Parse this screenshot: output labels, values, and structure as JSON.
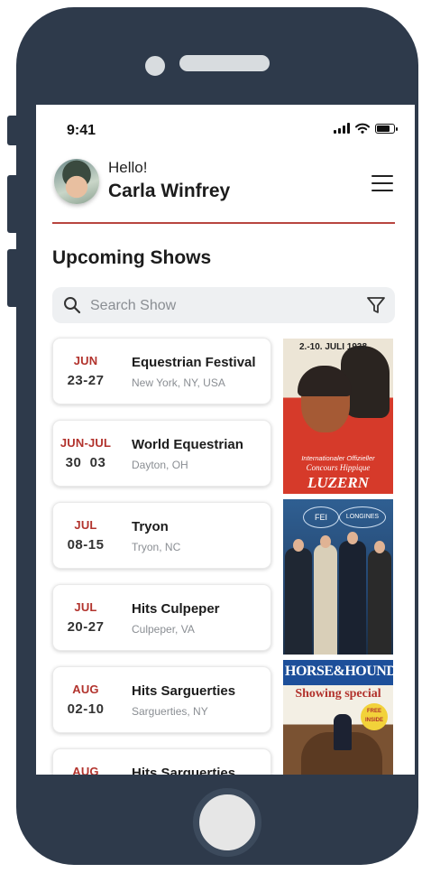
{
  "status_bar": {
    "time": "9:41",
    "battery_level": 0.8
  },
  "header": {
    "greeting": "Hello!",
    "user_name": "Carla Winfrey"
  },
  "section": {
    "title": "Upcoming Shows"
  },
  "search": {
    "placeholder": "Search Show",
    "value": ""
  },
  "shows": [
    {
      "month": "JUN",
      "days": "23-27",
      "title": "Equestrian Festival",
      "location": "New York, NY, USA"
    },
    {
      "month": "JUN-JUL",
      "days": "30  03",
      "title": "World Equestrian",
      "location": "Dayton, OH"
    },
    {
      "month": "JUL",
      "days": "08-15",
      "title": "Tryon",
      "location": "Tryon, NC"
    },
    {
      "month": "JUL",
      "days": "20-27",
      "title": "Hits Culpeper",
      "location": "Culpeper, VA"
    },
    {
      "month": "AUG",
      "days": "02-10",
      "title": "Hits Sarguerties",
      "location": "Sarguerties, NY"
    },
    {
      "month": "AUG",
      "days": "",
      "title": "Hits Sarguerties",
      "location": ""
    }
  ],
  "media": {
    "poster": {
      "year": "2.-10. JULI 1938",
      "caption_1": "Internationaler Offizieller",
      "caption_2": "Concours Hippique",
      "caption_3": "LUZERN"
    },
    "photo": {
      "logo_1": "FEI",
      "logo_2": "LONGINES"
    },
    "magazine": {
      "masthead": "HORSE&HOUND",
      "subtitle": "Showing special",
      "badge": "FREE INSIDE"
    }
  },
  "colors": {
    "frame": "#2e3a4b",
    "accent": "#b2332d",
    "divider": "#b8453f",
    "search_bg": "#eef0f2"
  }
}
